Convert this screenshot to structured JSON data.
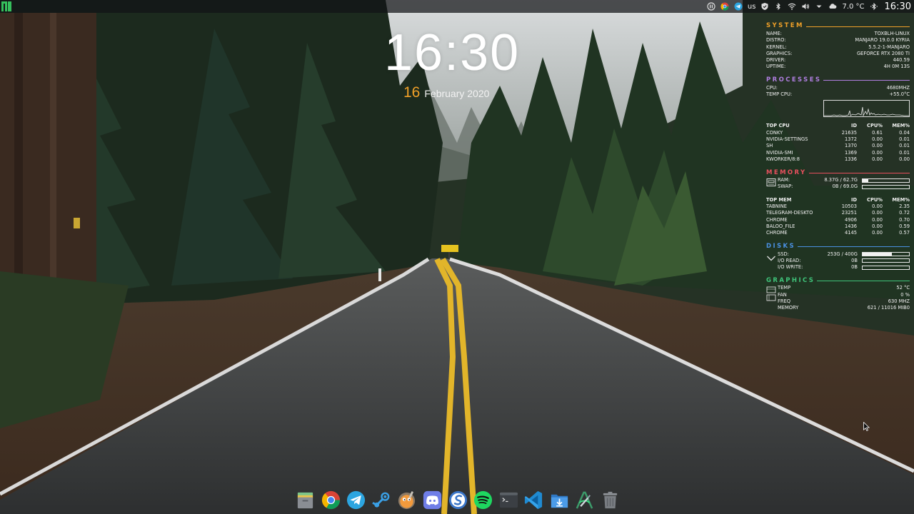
{
  "top_panel": {
    "keyboard_layout": "us",
    "weather": "7.0 °C",
    "clock": "16:30"
  },
  "desktop_clock": {
    "time": "16:30",
    "day": "16",
    "month_year": "February 2020"
  },
  "conky": {
    "system": {
      "title": "SYSTEM",
      "color": "#f0a028",
      "rows": [
        {
          "k": "NAME:",
          "v": "TOXBLH-LINUX"
        },
        {
          "k": "DISTRO:",
          "v": "MANJARO 19.0.0 KYRIA"
        },
        {
          "k": "KERNEL:",
          "v": "5.5.2-1-MANJARO"
        },
        {
          "k": "GRAPHICS:",
          "v": "GEFORCE RTX 2080 TI"
        },
        {
          "k": "DRIVER:",
          "v": "440.59"
        },
        {
          "k": "UPTIME:",
          "v": "4H 0M 13S"
        }
      ]
    },
    "processes": {
      "title": "PROCESSES",
      "color": "#b07ee0",
      "rows": [
        {
          "k": "CPU:",
          "v": "4680MHZ"
        },
        {
          "k": "TEMP CPU:",
          "v": "+55.0°C"
        }
      ]
    },
    "top_cpu": {
      "headers": [
        "TOP CPU",
        "ID",
        "CPU%",
        "MEM%"
      ],
      "rows": [
        [
          "CONKY",
          "21635",
          "0.61",
          "0.04"
        ],
        [
          "NVIDIA-SETTINGS",
          "1372",
          "0.00",
          "0.01"
        ],
        [
          "SH",
          "1370",
          "0.00",
          "0.01"
        ],
        [
          "NVIDIA-SMI",
          "1369",
          "0.00",
          "0.01"
        ],
        [
          "KWORKER/8:8",
          "1336",
          "0.00",
          "0.00"
        ]
      ]
    },
    "memory": {
      "title": "MEMORY",
      "color": "#e8505e",
      "ram_label": "RAM:",
      "ram_value": "8.37G / 62.7G",
      "ram_fraction": 0.13,
      "swap_label": "SWAP:",
      "swap_value": "0B / 69.0G",
      "swap_fraction": 0.0
    },
    "top_mem": {
      "headers": [
        "TOP MEM",
        "ID",
        "CPU%",
        "MEM%"
      ],
      "rows": [
        [
          "TABNINE",
          "10503",
          "0.00",
          "2.35"
        ],
        [
          "TELEGRAM-DESKTO",
          "23251",
          "0.00",
          "0.72"
        ],
        [
          "CHROME",
          "4906",
          "0.00",
          "0.70"
        ],
        [
          "BALOO_FILE",
          "1436",
          "0.00",
          "0.59"
        ],
        [
          "CHROME",
          "4145",
          "0.00",
          "0.57"
        ]
      ]
    },
    "disks": {
      "title": "DISKS",
      "color": "#4a90e2",
      "ssd_label": "SSD:",
      "ssd_value": "253G / 400G",
      "ssd_fraction": 0.63,
      "io_read_label": "I/O READ:",
      "io_read_value": "0B",
      "io_write_label": "I/O WRITE:",
      "io_write_value": "0B"
    },
    "graphics": {
      "title": "GRAPHICS",
      "color": "#3fc47a",
      "rows": [
        {
          "k": "TEMP",
          "v": "52 °C"
        },
        {
          "k": "FAN",
          "v": "0 %"
        },
        {
          "k": "FREQ",
          "v": "630 MHZ"
        },
        {
          "k": "MEMORY",
          "v": "621 / 11016 MIB0"
        }
      ]
    }
  },
  "dock": [
    {
      "name": "files-icon"
    },
    {
      "name": "chrome-icon"
    },
    {
      "name": "telegram-icon"
    },
    {
      "name": "steam-icon"
    },
    {
      "name": "gimp-icon"
    },
    {
      "name": "discord-icon"
    },
    {
      "name": "simplenote-icon"
    },
    {
      "name": "spotify-icon"
    },
    {
      "name": "terminal-icon"
    },
    {
      "name": "vscode-icon"
    },
    {
      "name": "downloads-icon"
    },
    {
      "name": "android-studio-icon"
    },
    {
      "name": "trash-icon"
    }
  ]
}
